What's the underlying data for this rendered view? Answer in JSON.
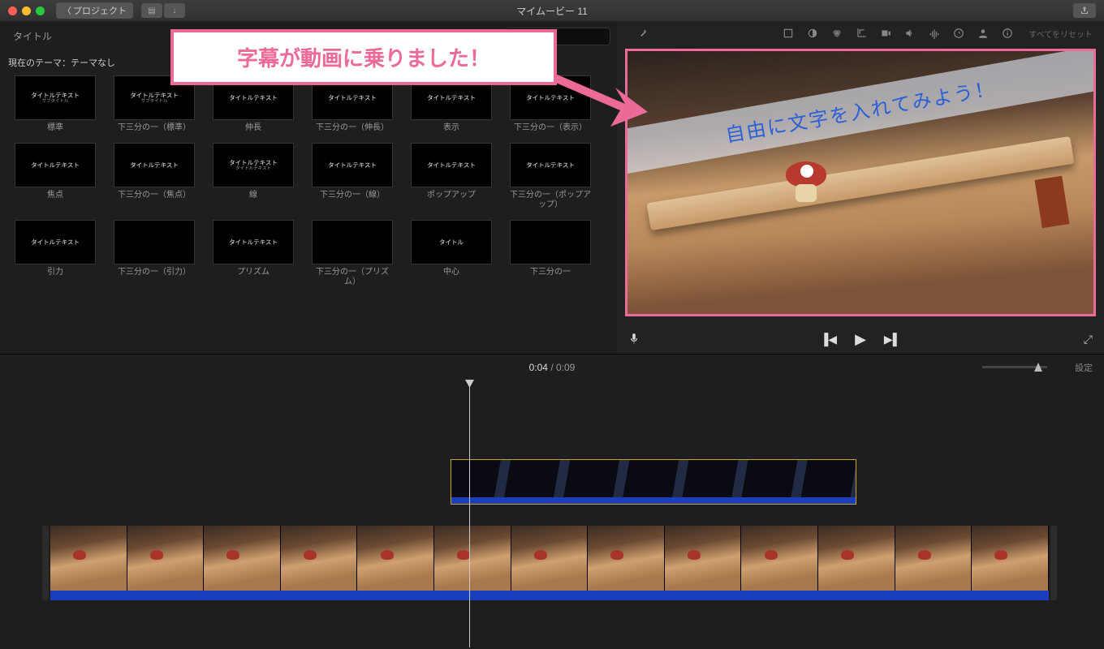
{
  "window": {
    "back_label": "プロジェクト",
    "app_title": "マイムービー 11"
  },
  "annotation": {
    "text": "字幕が動画に乗りました！"
  },
  "browser": {
    "tab_label": "タイトル",
    "search_placeholder": "",
    "section_label": "現在のテーマ：テーマなし",
    "titles": [
      {
        "thumb": "タイトルテキスト",
        "sub": "サブタイトル",
        "name": "標準"
      },
      {
        "thumb": "タイトルテキスト",
        "sub": "サブタイトル",
        "name": "下三分の一（標準）"
      },
      {
        "thumb": "タイトルテキスト",
        "sub": "",
        "name": "伸長"
      },
      {
        "thumb": "タイトルテキスト",
        "sub": "",
        "name": "下三分の一（伸長）"
      },
      {
        "thumb": "タイトルテキスト",
        "sub": "",
        "name": "表示"
      },
      {
        "thumb": "タイトルテキスト",
        "sub": "",
        "name": "下三分の一（表示）"
      },
      {
        "thumb": "タイトルテキスト",
        "sub": "",
        "name": "焦点"
      },
      {
        "thumb": "タイトルテキスト",
        "sub": "",
        "name": "下三分の一（焦点）"
      },
      {
        "thumb": "タイトルテキスト",
        "sub": "タイトルテキスト",
        "name": "線"
      },
      {
        "thumb": "タイトルテキスト",
        "sub": "",
        "name": "下三分の一（線）"
      },
      {
        "thumb": "タイトルテキスト",
        "sub": "",
        "name": "ポップアップ"
      },
      {
        "thumb": "タイトルテキスト",
        "sub": "",
        "name": "下三分の一（ポップアップ）"
      },
      {
        "thumb": "タイトルテキスト",
        "sub": "",
        "name": "引力"
      },
      {
        "thumb": "",
        "sub": "",
        "name": "下三分の一（引力）"
      },
      {
        "thumb": "タイトルテキスト",
        "sub": "",
        "name": "プリズム"
      },
      {
        "thumb": "",
        "sub": "",
        "name": "下三分の一（プリズム）"
      },
      {
        "thumb": "タイトル",
        "sub": "",
        "name": "中心"
      },
      {
        "thumb": "",
        "sub": "",
        "name": "下三分の一"
      }
    ]
  },
  "viewer": {
    "reset_label": "すべてをリセット",
    "overlay_text": "自由に文字を入れてみよう！"
  },
  "timecode": {
    "current": "0:04",
    "total": "0:09",
    "settings_label": "設定"
  }
}
